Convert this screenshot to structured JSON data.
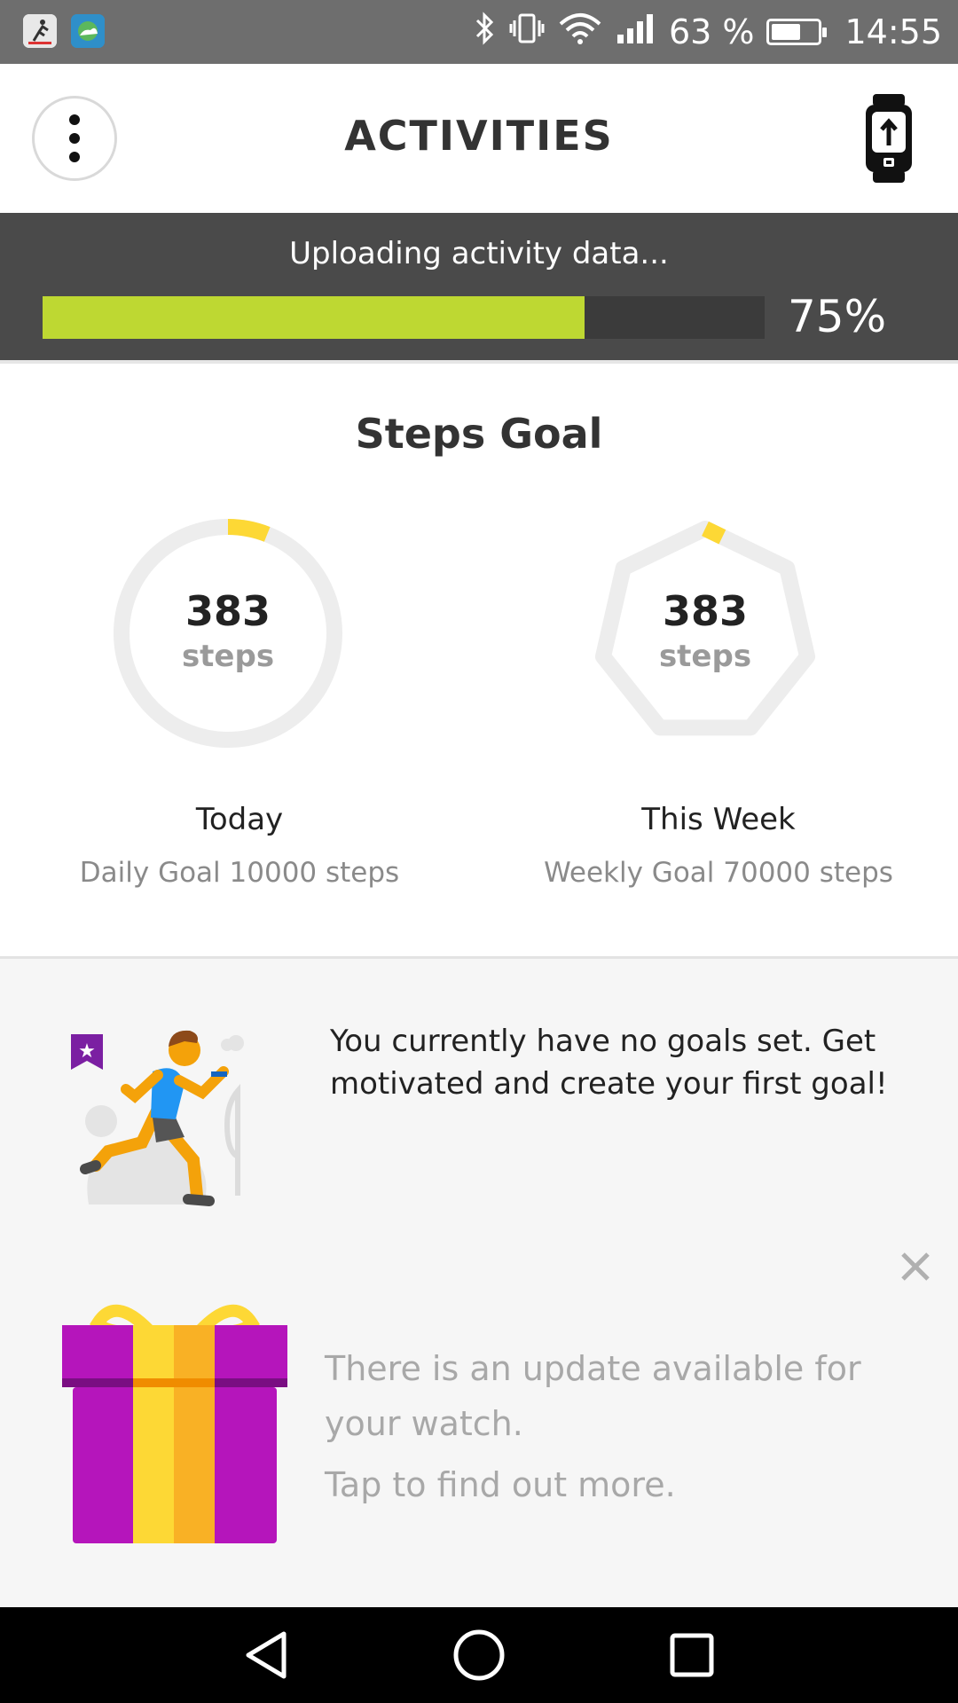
{
  "status_bar": {
    "battery_percent": "63 %",
    "battery_level": 0.63,
    "time": "14:55",
    "icons": [
      "tomtom-sports-app-icon",
      "weather-app-icon",
      "bluetooth-icon",
      "vibrate-icon",
      "wifi-icon",
      "signal-icon",
      "battery-icon"
    ]
  },
  "header": {
    "title": "ACTIVITIES",
    "menu_icon": "more-vertical-icon",
    "sync_icon": "watch-upload-icon"
  },
  "upload": {
    "text": "Uploading activity data...",
    "progress": 0.75,
    "percent_label": "75%",
    "accent_color": "#bed832"
  },
  "steps_goal": {
    "title": "Steps Goal",
    "today": {
      "value": "383",
      "unit": "steps",
      "label": "Today",
      "goal_text": "Daily Goal 10000 steps",
      "progress": 0.0383
    },
    "week": {
      "value": "383",
      "unit": "steps",
      "label": "This Week",
      "goal_text": "Weekly Goal 70000 steps",
      "progress": 0.0055
    },
    "ring_color": "#ededed",
    "progress_color": "#fdd835"
  },
  "no_goals": {
    "text": "You currently have no goals set. Get motivated and create your first goal!",
    "illustration": "runner-illustration"
  },
  "update_card": {
    "text": "There is an update available for your watch.",
    "tap_text": "Tap to find out more.",
    "icon": "gift-icon",
    "close_icon": "close-icon"
  },
  "nav_bar": {
    "icons": [
      "back-icon",
      "home-icon",
      "recents-icon"
    ]
  }
}
